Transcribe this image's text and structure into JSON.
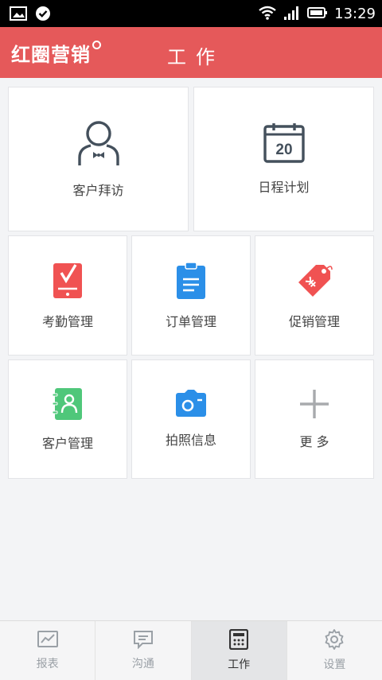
{
  "status": {
    "time": "13:29"
  },
  "header": {
    "brand": "红圈营销",
    "title": "工作"
  },
  "tiles": [
    {
      "label": "客户拜访",
      "icon": "customer-visit-icon"
    },
    {
      "label": "日程计划",
      "icon": "calendar-icon",
      "calendar_day": "20"
    },
    {
      "label": "考勤管理",
      "icon": "attendance-icon",
      "color": "#f05252"
    },
    {
      "label": "订单管理",
      "icon": "order-clipboard-icon",
      "color": "#2b8fe8"
    },
    {
      "label": "促销管理",
      "icon": "promotion-tag-icon",
      "color": "#f05252"
    },
    {
      "label": "客户管理",
      "icon": "contacts-book-icon",
      "color": "#4fc77a"
    },
    {
      "label": "拍照信息",
      "icon": "camera-icon",
      "color": "#2b8fe8"
    },
    {
      "label": "更 多",
      "icon": "plus-icon"
    }
  ],
  "nav": [
    {
      "label": "报表",
      "icon": "report-chart-icon"
    },
    {
      "label": "沟通",
      "icon": "chat-icon"
    },
    {
      "label": "工作",
      "icon": "calculator-icon",
      "active": true
    },
    {
      "label": "设置",
      "icon": "gear-icon"
    }
  ]
}
